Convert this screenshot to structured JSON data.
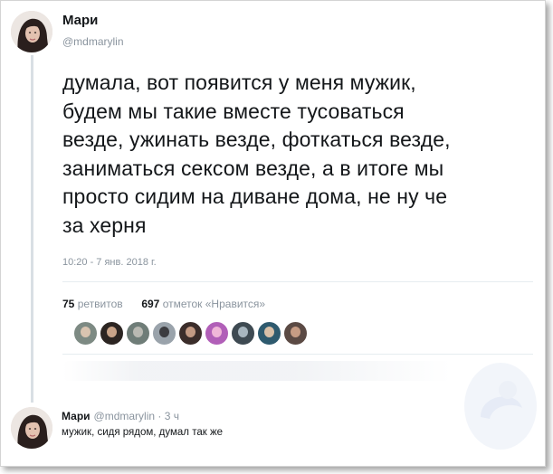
{
  "tweet": {
    "author_name": "Мари",
    "author_handle": "@mdmarylin",
    "text": "думала, вот появится у меня мужик,\nбудем мы такие вместе тусоваться\nвезде, ужинать везде, фоткаться везде,\nзаниматься сексом везде, а в итоге мы\nпросто сидим на диване дома, не ну че\nза херня",
    "timestamp": "10:20 - 7 янв. 2018 г.",
    "retweets_count": "75",
    "retweets_label": "ретвитов",
    "likes_count": "697",
    "likes_label": "отметок «Нравится»",
    "liker_avatars": [
      {
        "name": "liker-avatar-1",
        "bg": "#7d8a83",
        "face": "#d9c4b0"
      },
      {
        "name": "liker-avatar-2",
        "bg": "#2c2522",
        "face": "#c9a489"
      },
      {
        "name": "liker-avatar-3",
        "bg": "#6f7d78",
        "face": "#b9b9b2"
      },
      {
        "name": "liker-avatar-4",
        "bg": "#9aa3ab",
        "face": "#3c3c40"
      },
      {
        "name": "liker-avatar-5",
        "bg": "#3b2d2a",
        "face": "#c39a83"
      },
      {
        "name": "liker-avatar-6",
        "bg": "#b15fb8",
        "face": "#f0b6d8"
      },
      {
        "name": "liker-avatar-7",
        "bg": "#3e4a52",
        "face": "#a8b6bf"
      },
      {
        "name": "liker-avatar-8",
        "bg": "#2e5a6e",
        "face": "#d8c0a8"
      },
      {
        "name": "liker-avatar-9",
        "bg": "#5b4a44",
        "face": "#c79c84"
      }
    ]
  },
  "reply": {
    "author_name": "Мари",
    "meta": "@mdmarylin · 3 ч",
    "text": "мужик, сидя рядом, думал так же"
  },
  "colors": {
    "text_primary": "#14171a",
    "text_secondary": "#8a949e",
    "divider": "#e6ecf0",
    "thread_line": "#d9dfe4"
  }
}
